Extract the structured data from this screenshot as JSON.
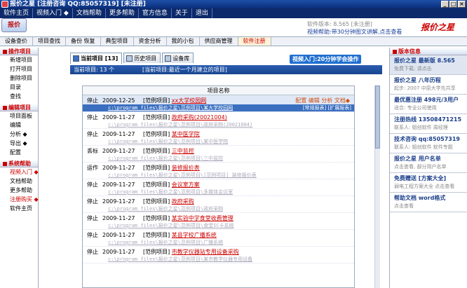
{
  "window": {
    "title": "报价之星 [注册咨询  QQ:85057319]  [未注册]",
    "app_icon": "app-icon"
  },
  "menu": [
    "软件主页",
    "视频入门 ◆",
    "文档帮助",
    "更多帮助",
    "官方信息",
    "关于",
    "退出"
  ],
  "header": {
    "logo": "报价",
    "soft_version": "软件版本: 8.565 [未注册]",
    "video_help": "视频帮助:带30分钟图文讲解,点击查看",
    "brand": "报价之星"
  },
  "toolbar": [
    "设备查价",
    "项目查找",
    "备份 恢复",
    "典型项目",
    "资金分析",
    "我的小包",
    "供应商管理",
    "软件注册"
  ],
  "left": {
    "sections": [
      {
        "title": "操作项目",
        "items": [
          "新增项目",
          "打开项目",
          "删除项目",
          "目录",
          "查找"
        ]
      },
      {
        "title": "编辑项目",
        "items": [
          "项目面板",
          "编辑",
          "分析 ◆",
          "导出 ◆",
          "配置"
        ]
      },
      {
        "title": "系统帮助",
        "items": [
          "视频入门 ◆",
          "文档帮助",
          "更多帮助",
          "注册购买 ◆",
          "软件主页"
        ]
      }
    ]
  },
  "center": {
    "tabs": [
      "当前项目 [13]",
      "历史项目",
      "设备库"
    ],
    "video_intro": "视频入门:20分钟学会操作",
    "info_count": "当前项目: 13 个",
    "info_filter": "[当前项目:最近一个月建立的项目]",
    "column_header": "项目名称",
    "rows": [
      {
        "status": "停止",
        "date": "2009-12-25",
        "tag": "[范例项目]",
        "name": "xx大学校园网",
        "path": "c:\\program files\\报价之星\\范例项目\\某大学校园网",
        "actions": "配置 编辑 分析 文档◆",
        "actions2": "[常规报表] [扩展报表]"
      },
      {
        "status": "停止",
        "date": "2009-11-27",
        "tag": "[范例项目]",
        "name": "政府采购(20021004)",
        "path": "c:\\program files\\报价之星\\范例项目\\政府采购(20021004)"
      },
      {
        "status": "停止",
        "date": "2009-11-27",
        "tag": "[范例项目]",
        "name": "某中医学院",
        "path": "c:\\program files\\报价之星\\范例项目\\某中医学院"
      },
      {
        "status": "丢标",
        "date": "2009-11-27",
        "tag": "[范例项目]",
        "name": "三中监控",
        "path": "c:\\program files\\报价之星\\范例项目\\三中监控"
      },
      {
        "status": "运作",
        "date": "2009-11-27",
        "tag": "[范例项目]",
        "name": "装修报价表",
        "path": "c:\\program files\\报价之星\\范例项目\\[范例项目] 装修报价表"
      },
      {
        "status": "停止",
        "date": "2009-11-27",
        "tag": "[范例项目]",
        "name": "会议室方案",
        "path": "c:\\program files\\报价之星\\范例项目\\多媒体会议室"
      },
      {
        "status": "停止",
        "date": "2009-11-27",
        "tag": "[范例项目]",
        "name": "政府采购",
        "path": "c:\\program files\\报价之星\\范例项目\\政府采购"
      },
      {
        "status": "停止",
        "date": "2009-11-27",
        "tag": "[范例项目]",
        "name": "某实验中学食堂收费管理",
        "path": "c:\\program files\\报价之星\\范例项目\\食堂IC卡系统"
      },
      {
        "status": "停止",
        "date": "2009-11-27",
        "tag": "[范例项目]",
        "name": "某县学校广播系统",
        "path": "c:\\program files\\报价之星\\范例项目\\广播系统"
      },
      {
        "status": "停止",
        "date": "2009-11-27",
        "tag": "[范例项目]",
        "name": "市教学仪器站专用设备采购",
        "path": "c:\\program files\\报价之星\\范例项目\\某市教学仪器专用设备"
      }
    ]
  },
  "right": {
    "title": "版本信息",
    "sections": [
      {
        "title": "报价之星 最新版 8.565",
        "sub": "免费下载; 请点击"
      },
      {
        "title": "报价之星 八年历程",
        "sub": "起步: 2007 中原大学先共享"
      },
      {
        "title": "最优惠注册 498元/3用户",
        "sub": "适合: 专业公司使用"
      },
      {
        "title": "注册热线 13508471215",
        "sub": "联系人: 姐创软件 周经理"
      },
      {
        "title": "技术咨询 qq:85057319",
        "sub": "联系人: 姐创软件 软件专题"
      },
      {
        "title": "报价之星 用户名单",
        "sub": "点击查看, 部分用户名单"
      },
      {
        "title": "免费赠送 [方案大全]",
        "sub": "弱电工程方案大全 点击查看"
      },
      {
        "title": "帮助文档 word格式",
        "sub": "点击查看"
      }
    ]
  }
}
